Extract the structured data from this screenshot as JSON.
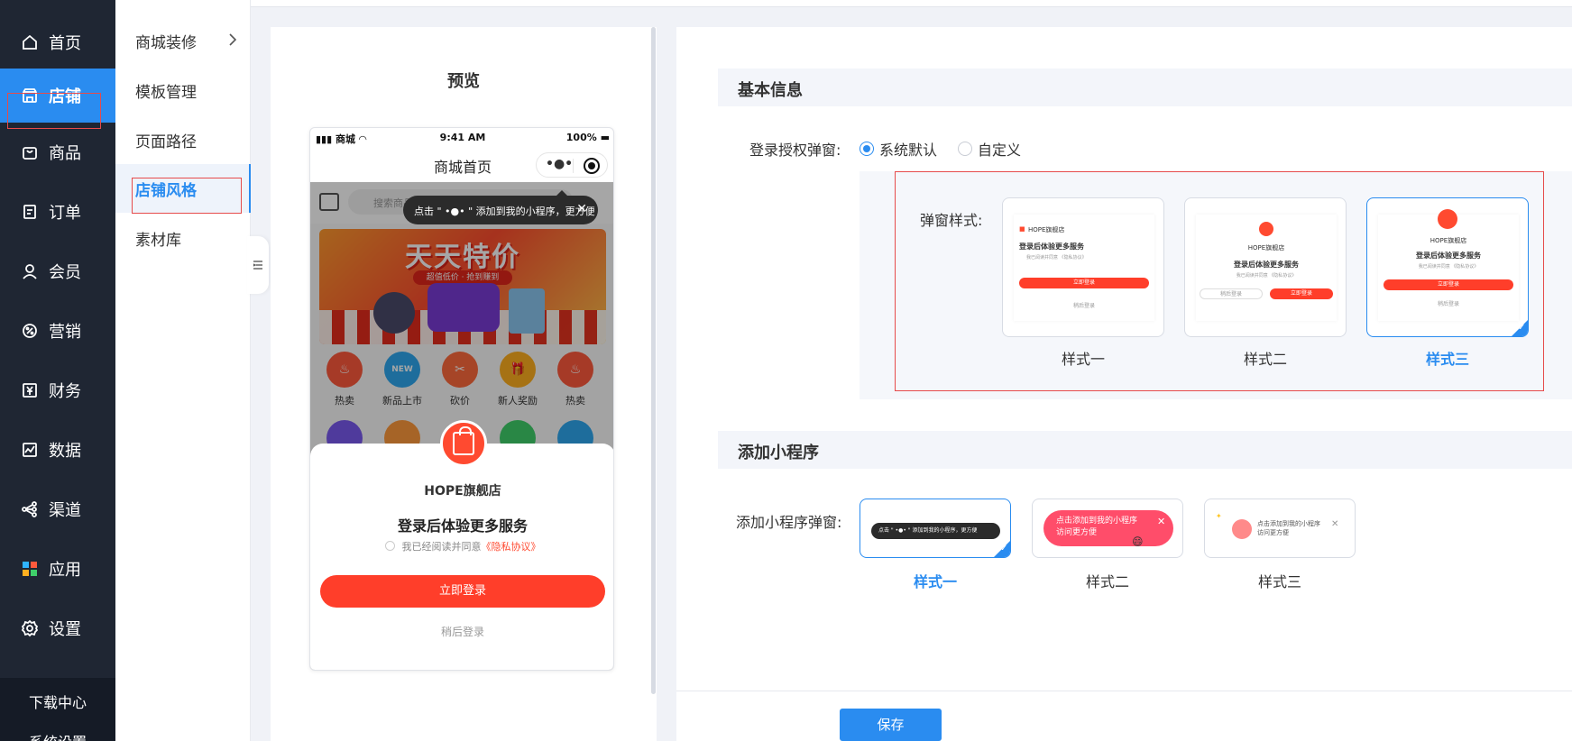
{
  "nav": {
    "items": [
      {
        "label": "首页",
        "icon": "home-icon"
      },
      {
        "label": "店铺",
        "icon": "store-icon",
        "active": true
      },
      {
        "label": "商品",
        "icon": "bag-icon"
      },
      {
        "label": "订单",
        "icon": "order-icon"
      },
      {
        "label": "会员",
        "icon": "user-icon"
      },
      {
        "label": "营销",
        "icon": "marketing-icon"
      },
      {
        "label": "财务",
        "icon": "yen-icon"
      },
      {
        "label": "数据",
        "icon": "chart-icon"
      },
      {
        "label": "渠道",
        "icon": "share-icon"
      },
      {
        "label": "应用",
        "icon": "apps-icon"
      },
      {
        "label": "设置",
        "icon": "gear-icon"
      }
    ],
    "bottom": {
      "download": "下载中心",
      "system": "系统设置"
    }
  },
  "submenu": {
    "items": [
      "商城装修",
      "模板管理",
      "页面路径",
      "店铺风格",
      "素材库"
    ],
    "active_index": 3
  },
  "preview": {
    "title": "预览",
    "status_left": "商城",
    "status_time": "9:41 AM",
    "status_battery": "100%",
    "page_title": "商城首页",
    "search_placeholder": "搜索商品",
    "tooltip": "点击 \" •●• \" 添加到我的小程序，更方便",
    "banner_title": "天天特价",
    "banner_sub": "超值低价 · 抢到赚到",
    "categories": [
      "热卖",
      "新品上市",
      "砍价",
      "新人奖励",
      "热卖"
    ],
    "category_badges": [
      "",
      "NEW",
      "",
      "",
      ""
    ],
    "shop_name": "HOPE旗舰店",
    "headline": "登录后体验更多服务",
    "agree_text": "我已经阅读并同意",
    "agree_link": "《隐私协议》",
    "login_btn": "立即登录",
    "later": "稍后登录"
  },
  "basic": {
    "title": "基本信息",
    "auth_label": "登录授权弹窗:",
    "radio_default": "系统默认",
    "radio_custom": "自定义",
    "popup_label": "弹窗样式:",
    "styles": [
      "样式一",
      "样式二",
      "样式三"
    ],
    "selected_style": 2,
    "mini_shop": "HOPE旗舰店",
    "mini_headline": "登录后体验更多服务",
    "mini_agree": "我已阅读并同意 《隐私协议》",
    "mini_login": "立即登录",
    "mini_later": "稍后登录"
  },
  "mp": {
    "title": "添加小程序",
    "label": "添加小程序弹窗:",
    "styles": [
      "样式一",
      "样式二",
      "样式三"
    ],
    "selected_style": 0,
    "s1_text": "点击 \" •●• \" 添加到我的小程序，更方便",
    "s2_text_1": "点击添加到我的小程序",
    "s2_text_2": "访问更方便",
    "s3_text_1": "点击添加到我的小程序",
    "s3_text_2": "访问更方便"
  },
  "footer": {
    "save": "保存"
  },
  "colors": {
    "primary": "#2a8cf0",
    "sidebar": "#1f2633",
    "accent_red": "#ff3e2a"
  }
}
